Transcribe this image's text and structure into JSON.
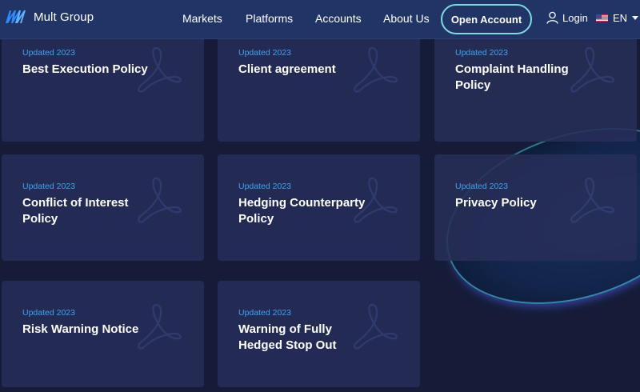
{
  "header": {
    "brand": "Mult Group",
    "nav": [
      "Markets",
      "Platforms",
      "Accounts",
      "About Us"
    ],
    "cta": "Open Account",
    "login": "Login",
    "language": "EN"
  },
  "documents": [
    {
      "updated": "Updated 2023",
      "title": "Best Execution Policy"
    },
    {
      "updated": "Updated 2023",
      "title": "Client agreement"
    },
    {
      "updated": "Updated 2023",
      "title": "Complaint Handling Policy"
    },
    {
      "updated": "Updated 2023",
      "title": "Conflict of Interest Policy"
    },
    {
      "updated": "Updated 2023",
      "title": "Hedging Counterparty Policy"
    },
    {
      "updated": "Updated 2023",
      "title": "Privacy Policy"
    },
    {
      "updated": "Updated 2023",
      "title": "Risk Warning Notice"
    },
    {
      "updated": "Updated 2023",
      "title": "Warning of Fully Hedged Stop Out"
    }
  ],
  "colors": {
    "background": "#161c38",
    "header": "#213466",
    "card": "#232b55",
    "updated_text": "#3da3f0",
    "cta_border": "#7fd8e2"
  },
  "icons": {
    "logo": "mult-group-logo",
    "user": "user-icon",
    "flag": "us-flag-icon",
    "caret": "chevron-down-icon",
    "document": "pdf-icon"
  }
}
